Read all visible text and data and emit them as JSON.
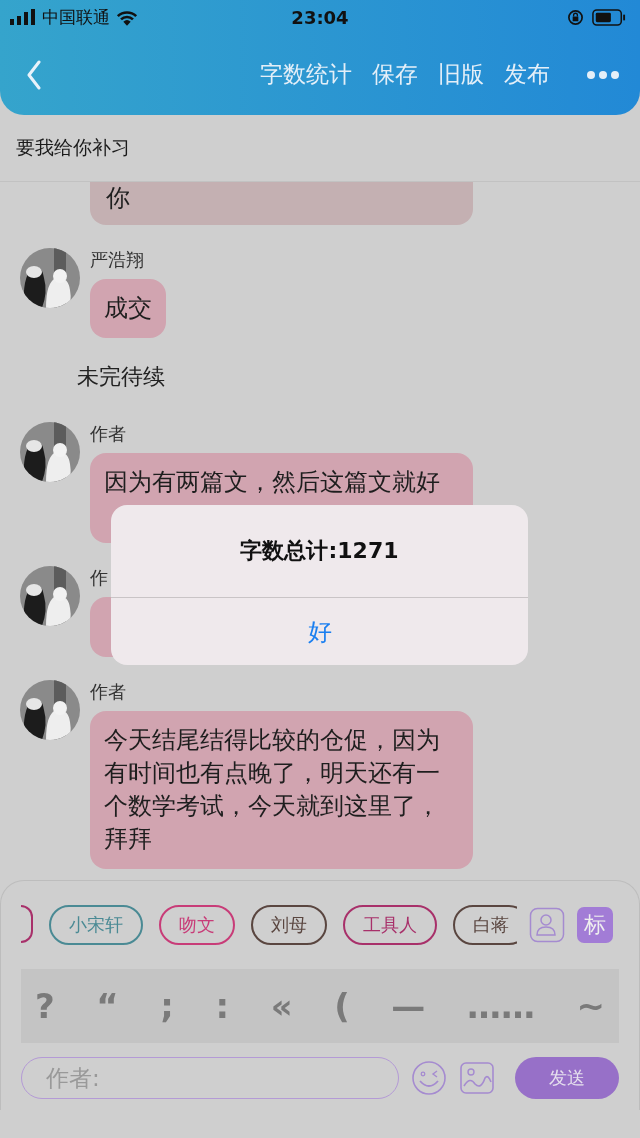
{
  "status_bar": {
    "carrier": "中国联通",
    "time": "23:04"
  },
  "nav": {
    "actions": [
      "字数统计",
      "保存",
      "旧版",
      "发布"
    ]
  },
  "subtitle": "要我给你补习",
  "messages": [
    {
      "kind": "cut",
      "text": "你"
    },
    {
      "kind": "message",
      "name": "严浩翔",
      "text": "成交"
    },
    {
      "kind": "note",
      "text": "未完待续"
    },
    {
      "kind": "covered",
      "name": "作者",
      "text": "因为有两篇文，然后这篇文就好"
    },
    {
      "kind": "covered",
      "name": "作"
    },
    {
      "kind": "message",
      "name": "作者",
      "text": "今天结尾结得比较的仓促，因为有时间也有点晚了，明天还有一个数学考试，今天就到这里了，拜拜"
    }
  ],
  "dialog": {
    "title": "字数总计:1271",
    "button": "好"
  },
  "tags": [
    {
      "label": "小宋轩",
      "color": "#4a8a94"
    },
    {
      "label": "吻文",
      "color": "#c83c78"
    },
    {
      "label": "刘母",
      "color": "#5a4640"
    },
    {
      "label": "工具人",
      "color": "#a8306a"
    },
    {
      "label": "白蒋",
      "color": "#5a4640"
    }
  ],
  "tag_button": "标",
  "punctuation": [
    "?",
    "“",
    ";",
    ":",
    "«",
    "(",
    "—",
    "……",
    "~"
  ],
  "composer": {
    "placeholder": "作者:",
    "send": "发送"
  }
}
